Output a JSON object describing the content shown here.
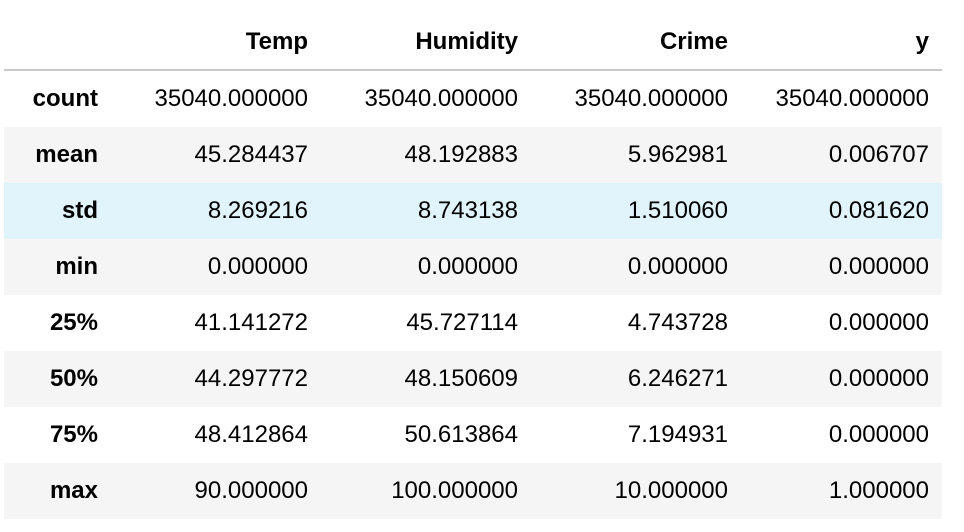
{
  "table": {
    "columns": [
      "",
      "Temp",
      "Humidity",
      "Crime",
      "y"
    ],
    "rows": [
      {
        "label": "count",
        "values": [
          "35040.000000",
          "35040.000000",
          "35040.000000",
          "35040.000000"
        ]
      },
      {
        "label": "mean",
        "values": [
          "45.284437",
          "48.192883",
          "5.962981",
          "0.006707"
        ]
      },
      {
        "label": "std",
        "values": [
          "8.269216",
          "8.743138",
          "1.510060",
          "0.081620"
        ]
      },
      {
        "label": "min",
        "values": [
          "0.000000",
          "0.000000",
          "0.000000",
          "0.000000"
        ]
      },
      {
        "label": "25%",
        "values": [
          "41.141272",
          "45.727114",
          "4.743728",
          "0.000000"
        ]
      },
      {
        "label": "50%",
        "values": [
          "44.297772",
          "48.150609",
          "6.246271",
          "0.000000"
        ]
      },
      {
        "label": "75%",
        "values": [
          "48.412864",
          "50.613864",
          "7.194931",
          "0.000000"
        ]
      },
      {
        "label": "max",
        "values": [
          "90.000000",
          "100.000000",
          "10.000000",
          "1.000000"
        ]
      }
    ],
    "hovered_row": "std",
    "colors": {
      "stripe": "#f5f5f5",
      "hover": "#e1f3fb",
      "header_rule": "#c8c8c8"
    }
  }
}
